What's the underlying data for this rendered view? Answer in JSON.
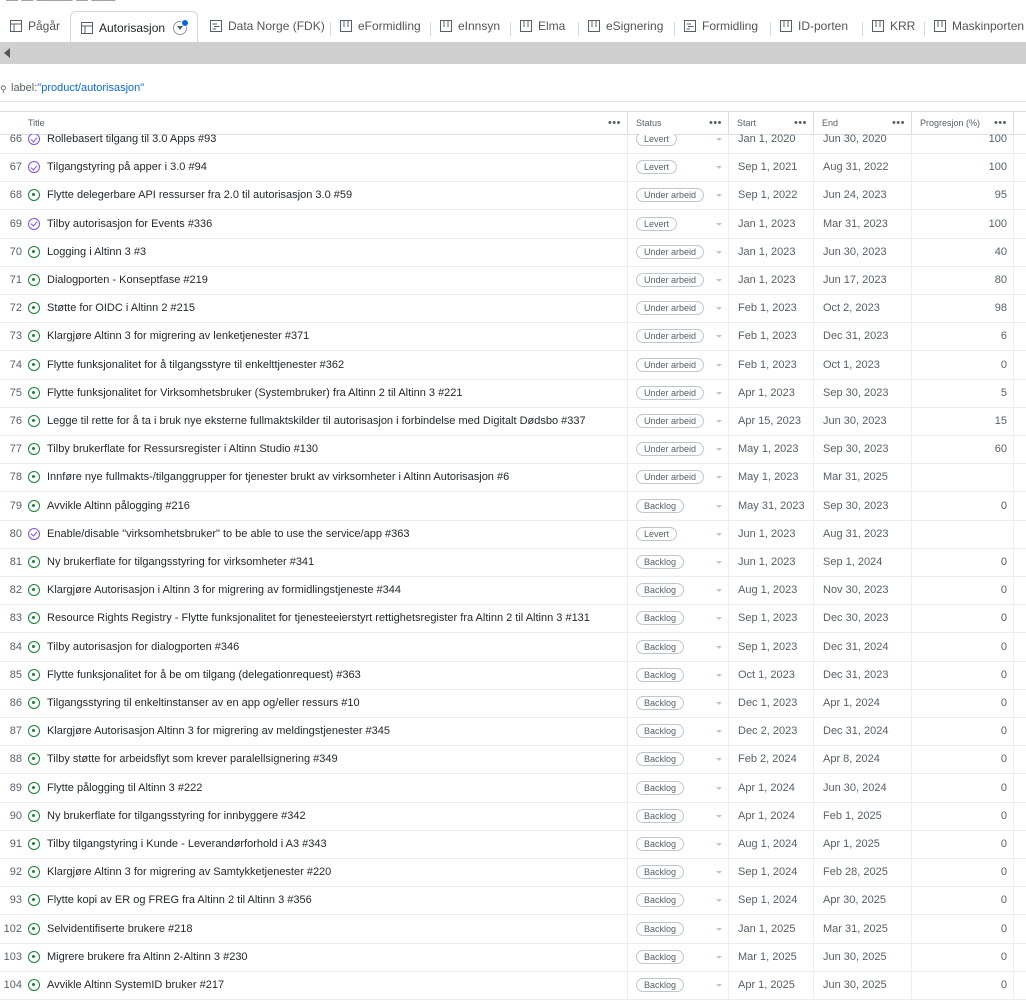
{
  "top_strip_text": "— — ——— — ——",
  "tabs": [
    {
      "label": "Pågår",
      "icon": "table-icon",
      "active": false
    },
    {
      "label": "Autorisasjon",
      "icon": "table-icon",
      "active": true
    },
    {
      "label": "Data Norge (FDK)",
      "icon": "roadmap-icon",
      "active": false
    },
    {
      "label": "eFormidling",
      "icon": "board-icon",
      "active": false
    },
    {
      "label": "eInnsyn",
      "icon": "board-icon",
      "active": false
    },
    {
      "label": "Elma",
      "icon": "board-icon",
      "active": false
    },
    {
      "label": "eSignering",
      "icon": "board-icon",
      "active": false
    },
    {
      "label": "Formidling",
      "icon": "roadmap-icon",
      "active": false
    },
    {
      "label": "ID-porten",
      "icon": "board-icon",
      "active": false
    },
    {
      "label": "KRR",
      "icon": "board-icon",
      "active": false
    },
    {
      "label": "Maskinporten",
      "icon": "board-icon",
      "active": false
    }
  ],
  "filter": {
    "prefix": "label:",
    "value": "\"product/autorisasjon\""
  },
  "columns": {
    "title": "Title",
    "status": "Status",
    "start": "Start",
    "end": "End",
    "progress": "Progresjon (%)"
  },
  "rows": [
    {
      "num": "66",
      "title": "Rollebasert tilgang til 3.0 Apps  #93",
      "state": "done",
      "status": "Levert",
      "start": "Jan 1, 2020",
      "end": "Jun 30, 2020",
      "progress": "100"
    },
    {
      "num": "67",
      "title": "Tilgangstyring på apper i 3.0  #94",
      "state": "done",
      "status": "Levert",
      "start": "Sep 1, 2021",
      "end": "Aug 31, 2022",
      "progress": "100"
    },
    {
      "num": "68",
      "title": "Flytte delegerbare API ressurser fra 2.0 til autorisasjon 3.0  #59",
      "state": "open",
      "status": "Under arbeid",
      "start": "Sep 1, 2022",
      "end": "Jun 24, 2023",
      "progress": "95"
    },
    {
      "num": "69",
      "title": "Tilby autorisasjon for Events  #336",
      "state": "done",
      "status": "Levert",
      "start": "Jan 1, 2023",
      "end": "Mar 31, 2023",
      "progress": "100"
    },
    {
      "num": "70",
      "title": "Logging i Altinn 3  #3",
      "state": "open",
      "status": "Under arbeid",
      "start": "Jan 1, 2023",
      "end": "Jun 30, 2023",
      "progress": "40"
    },
    {
      "num": "71",
      "title": "Dialogporten - Konseptfase  #219",
      "state": "open",
      "status": "Under arbeid",
      "start": "Jan 1, 2023",
      "end": "Jun 17, 2023",
      "progress": "80"
    },
    {
      "num": "72",
      "title": "Støtte for OIDC i Altinn 2  #215",
      "state": "open",
      "status": "Under arbeid",
      "start": "Feb 1, 2023",
      "end": "Oct 2, 2023",
      "progress": "98"
    },
    {
      "num": "73",
      "title": "Klargjøre Altinn 3 for migrering av lenketjenester  #371",
      "state": "open",
      "status": "Under arbeid",
      "start": "Feb 1, 2023",
      "end": "Dec 31, 2023",
      "progress": "6"
    },
    {
      "num": "74",
      "title": "Flytte funksjonalitet for å tilgangsstyre til enkelttjenester  #362",
      "state": "open",
      "status": "Under arbeid",
      "start": "Feb 1, 2023",
      "end": "Oct 1, 2023",
      "progress": "0"
    },
    {
      "num": "75",
      "title": "Flytte funksjonalitet for Virksomhetsbruker (Systembruker) fra Altinn 2 til Altinn 3  #221",
      "state": "open",
      "status": "Under arbeid",
      "start": "Apr 1, 2023",
      "end": "Sep 30, 2023",
      "progress": "5"
    },
    {
      "num": "76",
      "title": "Legge til rette for å ta i bruk nye eksterne fullmaktskilder til autorisasjon i forbindelse med Digitalt Dødsbo  #337",
      "state": "open",
      "status": "Under arbeid",
      "start": "Apr 15, 2023",
      "end": "Jun 30, 2023",
      "progress": "15"
    },
    {
      "num": "77",
      "title": "Tilby brukerflate for Ressursregister i Altinn Studio  #130",
      "state": "open",
      "status": "Under arbeid",
      "start": "May 1, 2023",
      "end": "Sep 30, 2023",
      "progress": "60"
    },
    {
      "num": "78",
      "title": "Innføre nye fullmakts-/tilganggrupper for tjenester brukt av virksomheter i Altinn Autorisasjon  #6",
      "state": "open",
      "status": "Under arbeid",
      "start": "May 1, 2023",
      "end": "Mar 31, 2025",
      "progress": ""
    },
    {
      "num": "79",
      "title": "Avvikle Altinn pålogging  #216",
      "state": "open",
      "status": "Backlog",
      "start": "May 31, 2023",
      "end": "Sep 30, 2023",
      "progress": "0"
    },
    {
      "num": "80",
      "title": "Enable/disable \"virksomhetsbruker\" to be able to use the service/app  #363",
      "state": "done",
      "status": "Levert",
      "start": "Jun 1, 2023",
      "end": "Aug 31, 2023",
      "progress": ""
    },
    {
      "num": "81",
      "title": "Ny brukerflate for tilgangsstyring for virksomheter  #341",
      "state": "open",
      "status": "Backlog",
      "start": "Jun 1, 2023",
      "end": "Sep 1, 2024",
      "progress": "0"
    },
    {
      "num": "82",
      "title": "Klargjøre Autorisasjon i Altinn 3 for migrering av formidlingstjeneste  #344",
      "state": "open",
      "status": "Backlog",
      "start": "Aug 1, 2023",
      "end": "Nov 30, 2023",
      "progress": "0"
    },
    {
      "num": "83",
      "title": "Resource Rights Registry - Flytte funksjonalitet for tjenesteeierstyrt rettighetsregister fra Altinn 2 til Altinn 3  #131",
      "state": "open",
      "status": "Backlog",
      "start": "Sep 1, 2023",
      "end": "Dec 30, 2023",
      "progress": "0"
    },
    {
      "num": "84",
      "title": "Tilby autorisasjon for dialogporten  #346",
      "state": "open",
      "status": "Backlog",
      "start": "Sep 1, 2023",
      "end": "Dec 31, 2024",
      "progress": "0"
    },
    {
      "num": "85",
      "title": "Flytte funksjonalitet for å be om tilgang (delegationrequest)  #363",
      "state": "open",
      "status": "Backlog",
      "start": "Oct 1, 2023",
      "end": "Dec 31, 2023",
      "progress": "0"
    },
    {
      "num": "86",
      "title": "Tilgangsstyring til enkeltinstanser av en app og/eller ressurs  #10",
      "state": "open",
      "status": "Backlog",
      "start": "Dec 1, 2023",
      "end": "Apr 1, 2024",
      "progress": "0"
    },
    {
      "num": "87",
      "title": "Klargjøre Autorisasjon Altinn 3 for migrering av meldingstjenester  #345",
      "state": "open",
      "status": "Backlog",
      "start": "Dec 2, 2023",
      "end": "Dec 31, 2024",
      "progress": "0"
    },
    {
      "num": "88",
      "title": "Tilby støtte for arbeidsflyt som krever paralellsignering  #349",
      "state": "open",
      "status": "Backlog",
      "start": "Feb 2, 2024",
      "end": "Apr 8, 2024",
      "progress": "0"
    },
    {
      "num": "89",
      "title": "Flytte pålogging til Altinn 3  #222",
      "state": "open",
      "status": "Backlog",
      "start": "Apr 1, 2024",
      "end": "Jun 30, 2024",
      "progress": "0"
    },
    {
      "num": "90",
      "title": "Ny brukerflate for tilgangsstyring for innbyggere  #342",
      "state": "open",
      "status": "Backlog",
      "start": "Apr 1, 2024",
      "end": "Feb 1, 2025",
      "progress": "0"
    },
    {
      "num": "91",
      "title": "Tilby tilgangstyring i Kunde - Leverandørforhold i A3  #343",
      "state": "open",
      "status": "Backlog",
      "start": "Aug 1, 2024",
      "end": "Apr 1, 2025",
      "progress": "0"
    },
    {
      "num": "92",
      "title": "Klargjøre Altinn 3 for migrering av Samtykketjenester  #220",
      "state": "open",
      "status": "Backlog",
      "start": "Sep 1, 2024",
      "end": "Feb 28, 2025",
      "progress": "0"
    },
    {
      "num": "93",
      "title": "Flytte kopi av ER og FREG fra Altinn 2 til Altinn 3  #356",
      "state": "open",
      "status": "Backlog",
      "start": "Sep 1, 2024",
      "end": "Apr 30, 2025",
      "progress": "0"
    },
    {
      "num": "102",
      "title": "Selvidentifiserte brukere  #218",
      "state": "open",
      "status": "Backlog",
      "start": "Jan 1, 2025",
      "end": "Mar 31, 2025",
      "progress": "0"
    },
    {
      "num": "103",
      "title": "Migrere brukere fra Altinn 2-Altinn 3  #230",
      "state": "open",
      "status": "Backlog",
      "start": "Mar 1, 2025",
      "end": "Jun 30, 2025",
      "progress": "0"
    },
    {
      "num": "104",
      "title": "Avvikle Altinn SystemID bruker  #217",
      "state": "open",
      "status": "Backlog",
      "start": "Apr 1, 2025",
      "end": "Jun 30, 2025",
      "progress": "0"
    }
  ]
}
